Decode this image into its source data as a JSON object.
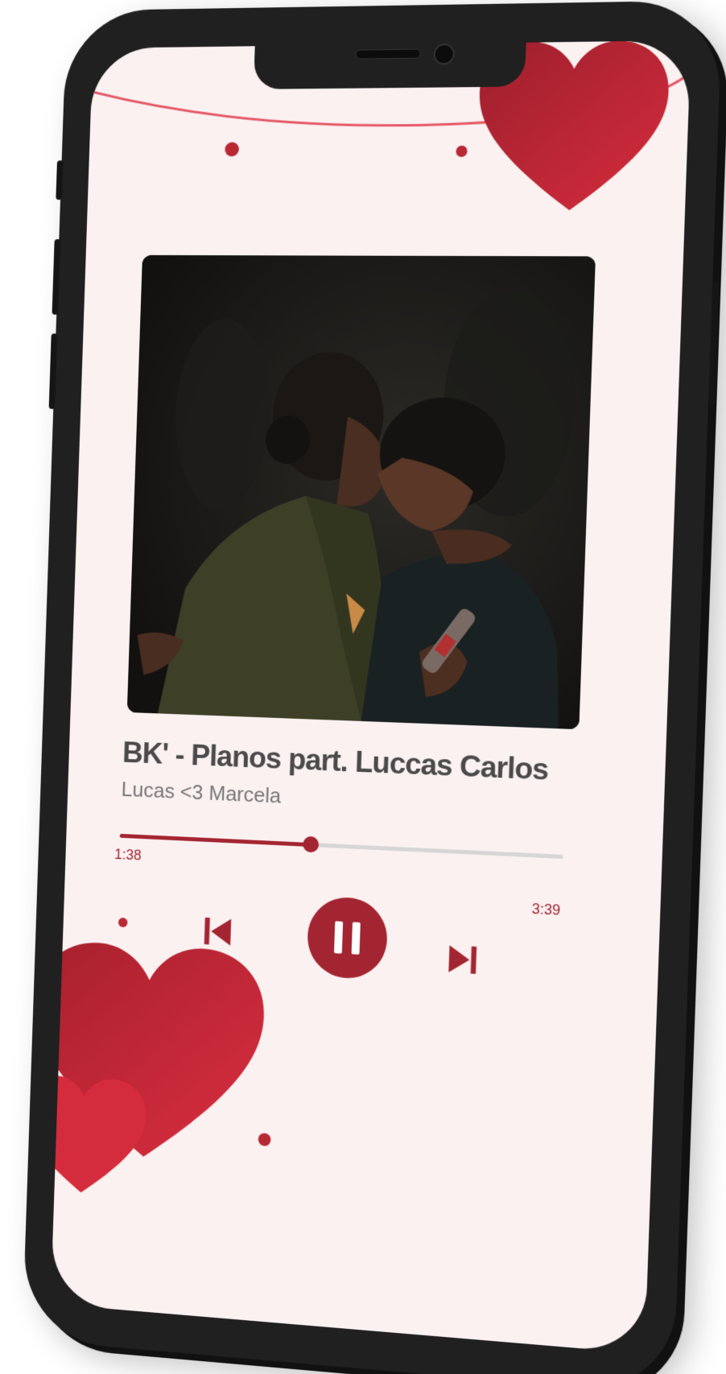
{
  "player": {
    "title": "BK' - Planos part. Luccas Carlos",
    "artist": "Lucas <3 Marcela",
    "current_time": "1:38",
    "total_time": "3:39",
    "progress": 0.44,
    "state": "playing"
  },
  "controls": {
    "previous": "previous-track",
    "play_pause": "pause",
    "next": "next-track"
  },
  "colors": {
    "accent": "#a32531",
    "heart_red": "#c6283a",
    "background": "#fbf1f1",
    "phone_frame": "#202020"
  },
  "icons": [
    "previous-icon",
    "pause-icon",
    "next-icon",
    "heart-icon"
  ]
}
